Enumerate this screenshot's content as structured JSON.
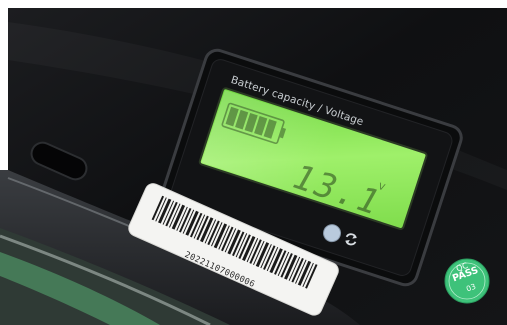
{
  "meter": {
    "title": "Battery capacity / Voltage",
    "reading": "13.1",
    "unit": "V"
  },
  "barcode_label": {
    "serial": "20221107000006"
  },
  "qc_sticker": {
    "top": "QC",
    "middle": "PASS",
    "bottom": "03"
  },
  "colors": {
    "battery_case": "#111214",
    "lcd_backlight": "#8fe35a",
    "qc_sticker": "#3ec27a",
    "reset_button": "#b9cadd"
  },
  "icons": {
    "reset": "refresh-icon",
    "battery_segments": "battery-level-icon"
  }
}
